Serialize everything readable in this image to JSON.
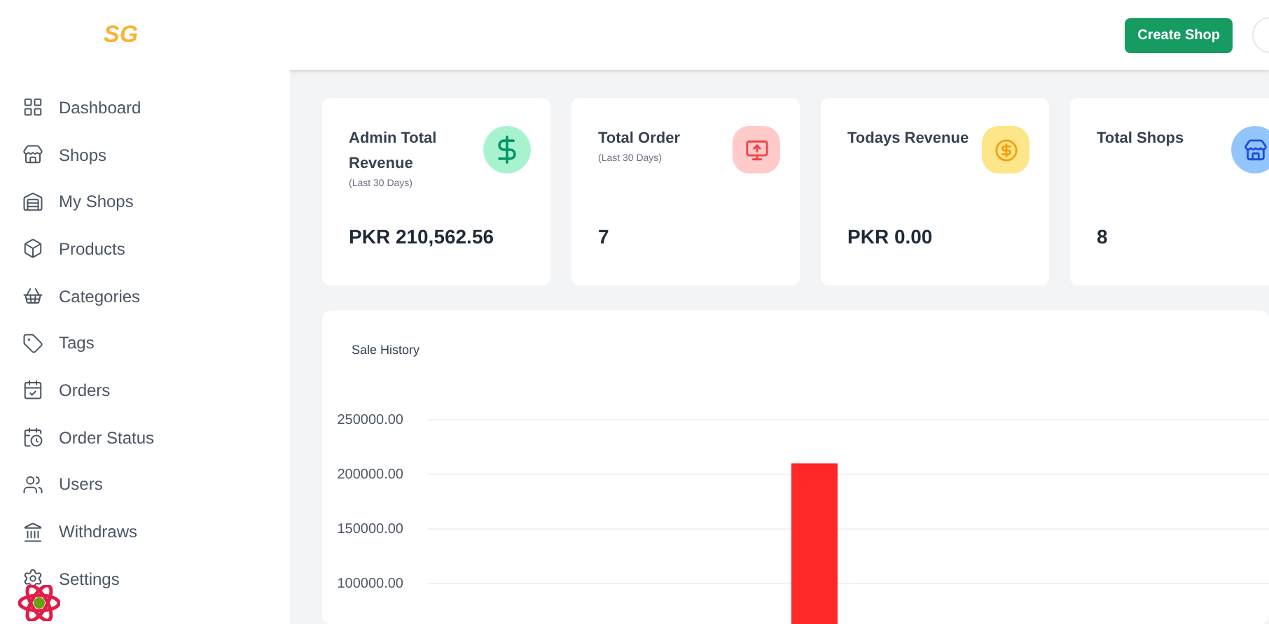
{
  "header": {
    "logo": "SG",
    "create_button": "Create Shop"
  },
  "sidebar": {
    "items": [
      {
        "label": "Dashboard",
        "selected": false
      },
      {
        "label": "Shops",
        "selected": false
      },
      {
        "label": "My Shops",
        "selected": false
      },
      {
        "label": "Products",
        "selected": false
      },
      {
        "label": "Categories",
        "selected": false
      },
      {
        "label": "Tags",
        "selected": false
      },
      {
        "label": "Orders",
        "selected": false
      },
      {
        "label": "Order Status",
        "selected": false
      },
      {
        "label": "Users",
        "selected": false
      },
      {
        "label": "Withdraws",
        "selected": false
      },
      {
        "label": "Settings",
        "selected": false
      }
    ]
  },
  "stats": [
    {
      "title": "Admin Total Revenue",
      "subtitle": "(Last 30 Days)",
      "value": "PKR 210,562.56",
      "color": "#a7f3d0"
    },
    {
      "title": "Total Order",
      "subtitle": "(Last 30 Days)",
      "value": "7",
      "color": "#fecaca"
    },
    {
      "title": "Todays Revenue",
      "value": "PKR 0.00",
      "color": "#fde68a"
    },
    {
      "title": "Total Shops",
      "value": "8",
      "color": "#93c5fd"
    }
  ],
  "sale_history": {
    "title": "Sale History",
    "chart_data": {
      "type": "bar",
      "series": [
        {
          "color": "#ff2727",
          "values": [
            210000
          ]
        }
      ],
      "ylim": [
        57700,
        250000
      ],
      "grid": true,
      "yticks": [
        {
          "value": 100000,
          "label": "100000.00"
        },
        {
          "value": 150000,
          "label": "150000.00"
        },
        {
          "value": 200000,
          "label": "200000.00"
        },
        {
          "value": 250000,
          "label": "250000.00"
        }
      ]
    }
  }
}
